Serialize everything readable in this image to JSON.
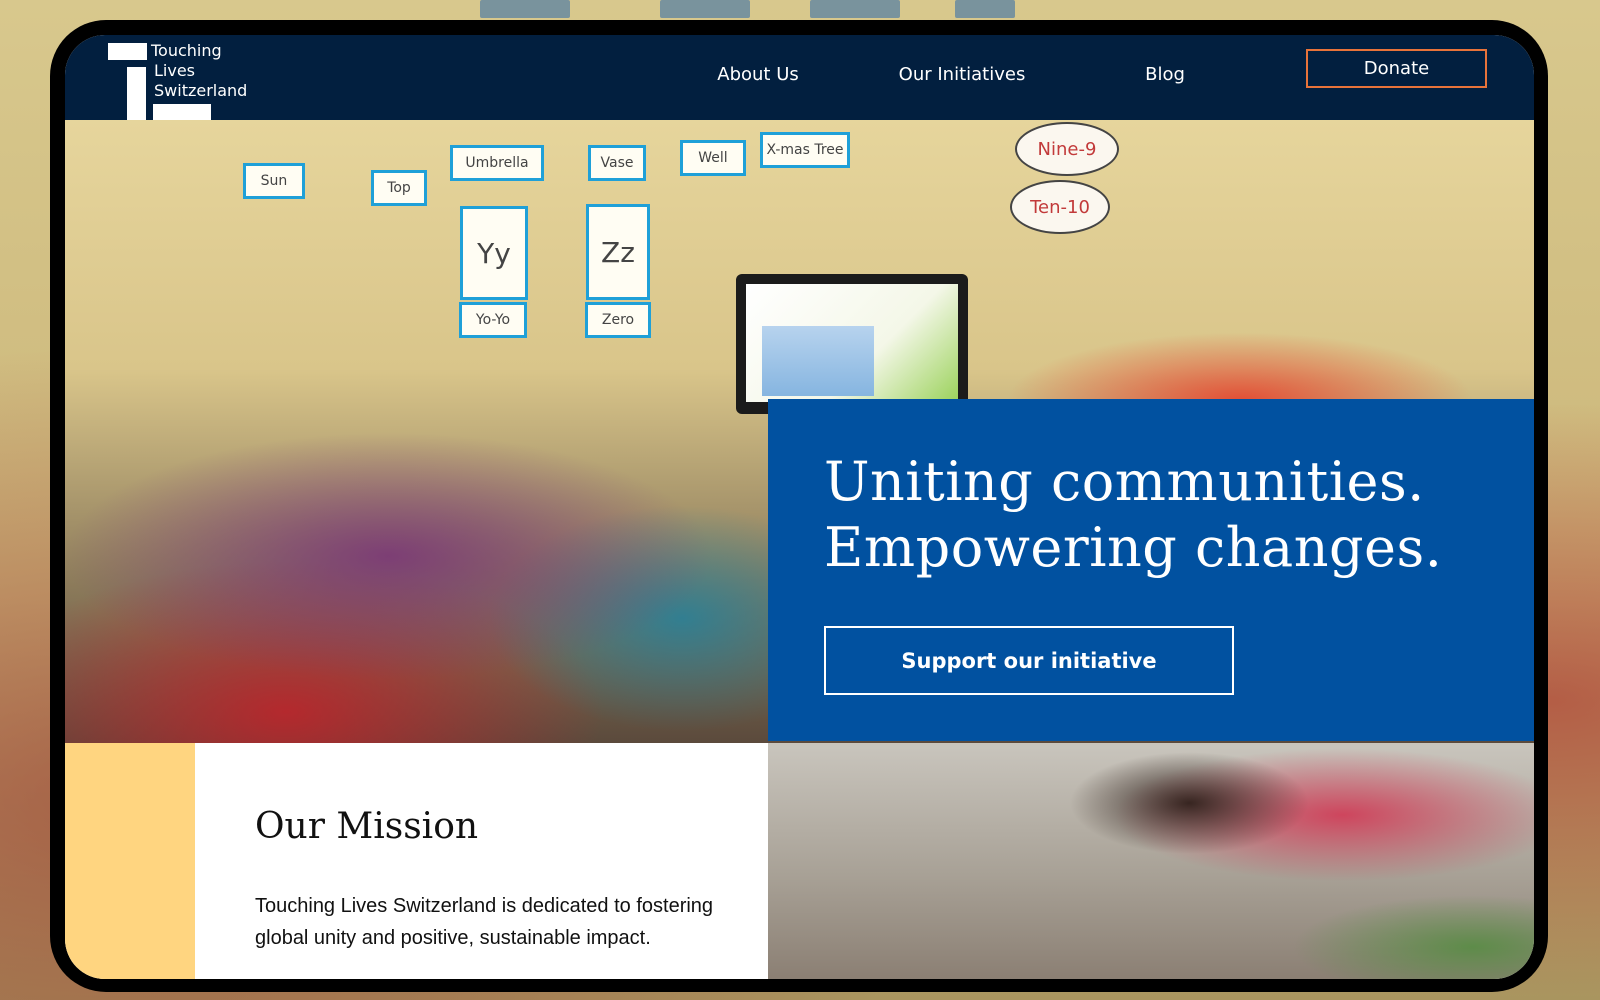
{
  "brand": {
    "line1": "Touching",
    "line2": "Lives",
    "line3": "Switzerland"
  },
  "nav": {
    "about": "About Us",
    "initiatives": "Our Initiatives",
    "blog": "Blog",
    "donate": "Donate"
  },
  "hero": {
    "title_line1": "Uniting communities.",
    "title_line2": "Empowering changes.",
    "cta": "Support our initiative"
  },
  "photo_labels": {
    "cards": [
      "Sun",
      "Top",
      "Umbrella",
      "Vase",
      "Well",
      "X-mas Tree",
      "Yy",
      "Zz",
      "Yo-Yo",
      "Zero"
    ],
    "ovals": [
      "Nine-9",
      "Ten-10"
    ]
  },
  "mission": {
    "title": "Our Mission",
    "text": "Touching Lives Switzerland is dedicated to fostering global unity and positive, sustainable impact."
  },
  "colors": {
    "header_bg": "#021f3f",
    "hero_panel": "#0151a0",
    "donate_border": "#e8733a",
    "accent_yellow": "#ffd580"
  }
}
